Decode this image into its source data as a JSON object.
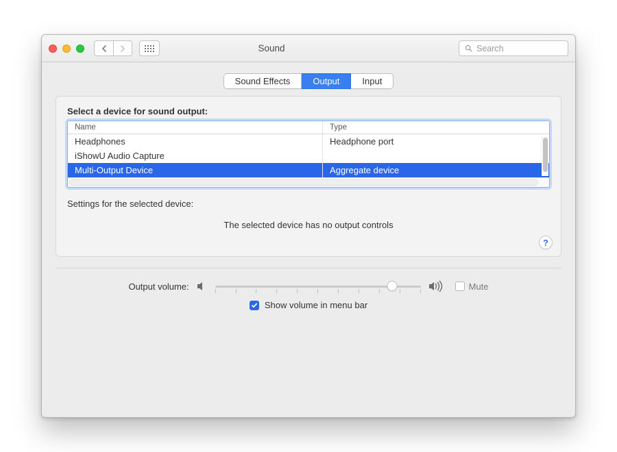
{
  "window": {
    "title": "Sound"
  },
  "search": {
    "placeholder": "Search"
  },
  "tabs": {
    "sound_effects": "Sound Effects",
    "output": "Output",
    "input": "Input"
  },
  "output": {
    "section_label": "Select a device for sound output:",
    "columns": {
      "name": "Name",
      "type": "Type"
    },
    "devices": [
      {
        "name": "Headphones",
        "type": "Headphone port"
      },
      {
        "name": "iShowU Audio Capture",
        "type": ""
      },
      {
        "name": "Multi-Output Device",
        "type": "Aggregate device"
      }
    ],
    "settings_label": "Settings for the selected device:",
    "no_controls": "The selected device has no output controls"
  },
  "volume": {
    "label": "Output volume:",
    "mute_label": "Mute",
    "menubar_label": "Show volume in menu bar"
  }
}
